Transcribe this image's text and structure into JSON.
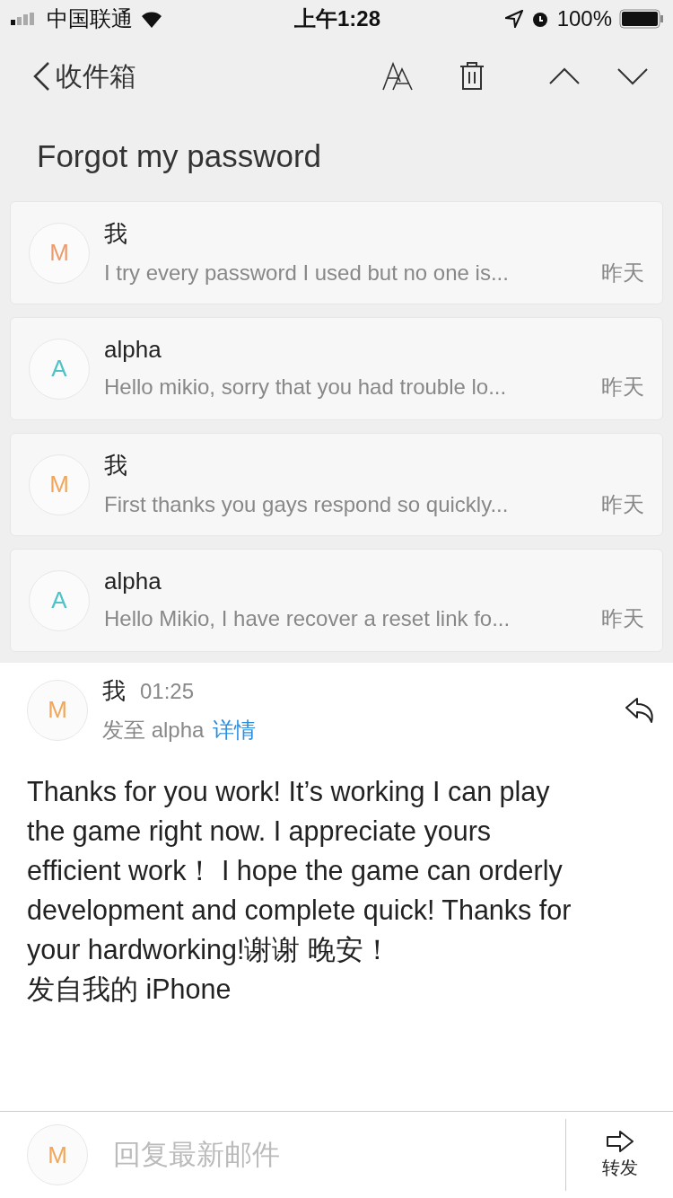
{
  "status_bar": {
    "carrier": "中国联通",
    "time": "上午1:28",
    "battery": "100%"
  },
  "nav": {
    "back_label": "收件箱"
  },
  "subject": "Forgot my password",
  "thread": [
    {
      "avatar": "M",
      "color": "#ee9a6a",
      "sender": "我",
      "preview": "I try every password I used but no one is...",
      "date": "昨天"
    },
    {
      "avatar": "A",
      "color": "#4fc3c8",
      "sender": "alpha",
      "preview": "Hello mikio, sorry that you had trouble lo...",
      "date": "昨天"
    },
    {
      "avatar": "M",
      "color": "#f2a65a",
      "sender": "我",
      "preview": "First thanks you gays respond so quickly...",
      "date": "昨天"
    },
    {
      "avatar": "A",
      "color": "#4fc3c8",
      "sender": "alpha",
      "preview": "Hello Mikio, I have recover a reset link fo...",
      "date": "昨天"
    }
  ],
  "open_message": {
    "avatar": "M",
    "color": "#f2a65a",
    "sender": "我",
    "time": "01:25",
    "to": "发至 alpha",
    "details_link": "详情",
    "body_lines": [
      "Thanks for you work! It’s working I can play",
      "the game right now. I appreciate yours",
      "efficient work！  I hope the game can orderly",
      "development and complete quick! Thanks for",
      "your hardworking!谢谢 晚安！",
      "发自我的 iPhone"
    ]
  },
  "reply_bar": {
    "avatar": "M",
    "color": "#f2a65a",
    "placeholder": "回复最新邮件",
    "forward_label": "转发"
  }
}
